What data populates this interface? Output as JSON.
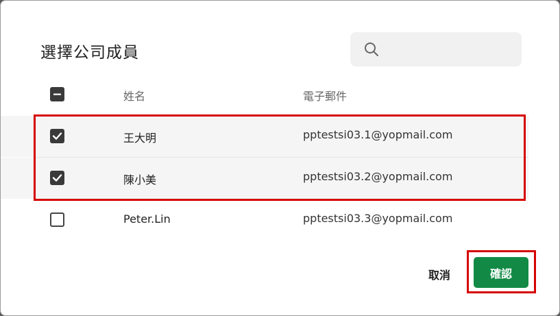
{
  "dialog": {
    "title": "選擇公司成員",
    "search": {
      "icon": "search-icon",
      "placeholder": "",
      "value": ""
    }
  },
  "table": {
    "header": {
      "select_all_state": "indeterminate",
      "name": "姓名",
      "email": "電子郵件"
    },
    "rows": [
      {
        "checked": true,
        "name": "王大明",
        "email": "pptestsi03.1@yopmail.com"
      },
      {
        "checked": true,
        "name": "陳小美",
        "email": "pptestsi03.2@yopmail.com"
      },
      {
        "checked": false,
        "name": "Peter.Lin",
        "email": "pptestsi03.3@yopmail.com"
      }
    ]
  },
  "actions": {
    "cancel_label": "取消",
    "confirm_label": "確認"
  },
  "colors": {
    "confirm_bg": "#128a45",
    "highlight": "#d60000",
    "checkbox_checked": "#3a3a3a"
  }
}
